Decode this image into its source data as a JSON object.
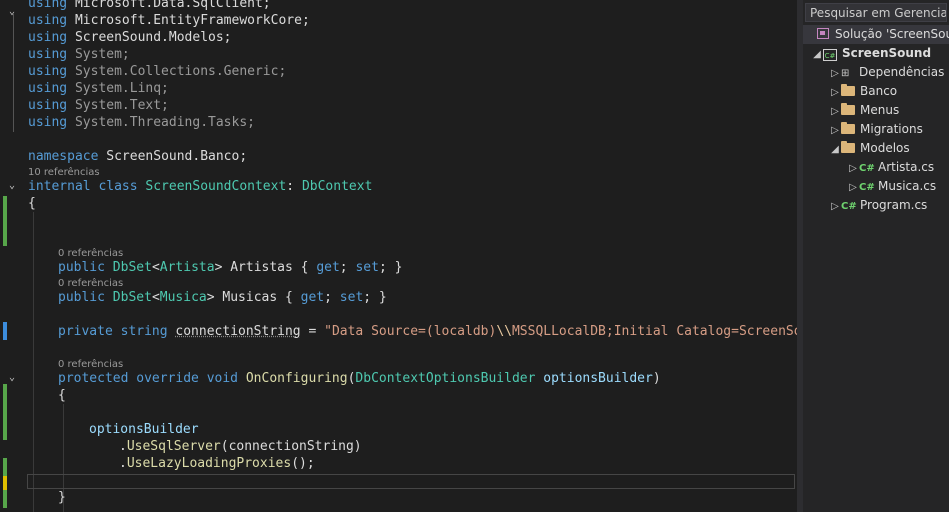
{
  "editor": {
    "usings": [
      {
        "kw": "using",
        "ns": "Microsoft.Data.SqlClient;"
      },
      {
        "kw": "using",
        "ns": "Microsoft.EntityFrameworkCore;"
      },
      {
        "kw": "using",
        "ns": "ScreenSound.Modelos;"
      },
      {
        "kw": "using",
        "ns": "System;"
      },
      {
        "kw": "using",
        "ns": "System.Collections.Generic;"
      },
      {
        "kw": "using",
        "ns": "System.Linq;"
      },
      {
        "kw": "using",
        "ns": "System.Text;"
      },
      {
        "kw": "using",
        "ns": "System.Threading.Tasks;"
      }
    ],
    "namespace_kw": "namespace",
    "namespace_name": " ScreenSound.Banco;",
    "class_refs": "10 referências",
    "class_mod": "internal class ",
    "class_name": "ScreenSoundContext",
    "class_colon": ": ",
    "class_base": "DbContext",
    "brace_open": "{",
    "brace_close": "}",
    "prop_refs_1": "0 referências",
    "prop1": {
      "kw": "public ",
      "type": "DbSet",
      "lt": "<",
      "arg": "Artista",
      "rest": "> Artistas { ",
      "get": "get",
      "semi1": "; ",
      "set": "set",
      "end": "; }"
    },
    "prop_refs_2": "0 referências",
    "prop2": {
      "kw": "public ",
      "type": "DbSet",
      "lt": "<",
      "arg": "Musica",
      "rest": "> Musicas { ",
      "get": "get",
      "semi1": "; ",
      "set": "set",
      "end": "; }"
    },
    "field": {
      "kw": "private string ",
      "name": "connectionString",
      "eq": " = ",
      "str1": "\"Data Source=(localdb)",
      "esc": "\\\\",
      "str2": "MSSQLLocalDB;Initial Catalog=ScreenSoun"
    },
    "method_refs": "0 referências",
    "method": {
      "kw": "protected override void ",
      "name": "OnConfiguring",
      "open": "(",
      "ptype": "DbContextOptionsBuilder",
      "pname": " optionsBuilder",
      "close": ")"
    },
    "body_line1": "optionsBuilder",
    "body_line2": {
      "dot": ".",
      "name": "UseSqlServer",
      "args": "(connectionString)"
    },
    "body_line3": {
      "dot": ".",
      "name": "UseLazyLoadingProxies",
      "args": "();"
    }
  },
  "explorer": {
    "search_placeholder": "Pesquisar em Gerenciador",
    "solution": "Solução 'ScreenSound'",
    "project": "ScreenSound",
    "project_badge": "C#",
    "items": [
      {
        "label": "Dependências",
        "kind": "deps"
      },
      {
        "label": "Banco",
        "kind": "folder"
      },
      {
        "label": "Menus",
        "kind": "folder"
      },
      {
        "label": "Migrations",
        "kind": "folder"
      },
      {
        "label": "Modelos",
        "kind": "folder-open"
      },
      {
        "label": "Artista.cs",
        "kind": "cs"
      },
      {
        "label": "Musica.cs",
        "kind": "cs"
      },
      {
        "label": "Program.cs",
        "kind": "cs"
      }
    ],
    "cs_badge": "C#"
  },
  "colors": {
    "background": "#1e1e1e",
    "keyword": "#569cd6",
    "type": "#4ec9b0",
    "method": "#dcdcaa",
    "string": "#d69d85",
    "change_bar": "#57a64a"
  }
}
